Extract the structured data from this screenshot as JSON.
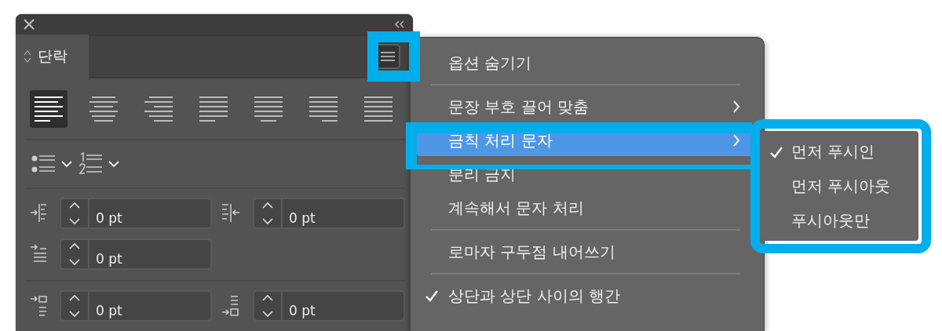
{
  "panel": {
    "tab": {
      "label": "단락",
      "selected": true
    },
    "alignment": [
      {
        "kind": "left",
        "selected": true
      },
      {
        "kind": "center",
        "selected": false
      },
      {
        "kind": "right",
        "selected": false
      },
      {
        "kind": "justify-left",
        "selected": false
      },
      {
        "kind": "justify-center",
        "selected": false
      },
      {
        "kind": "justify-right",
        "selected": false
      },
      {
        "kind": "justify-all",
        "selected": false
      }
    ],
    "field_rows": [
      [
        {
          "kind": "left-indent",
          "value": "0 pt"
        },
        {
          "kind": "right-indent",
          "value": "0 pt"
        }
      ],
      [
        {
          "kind": "first-line-indent",
          "value": "0 pt"
        }
      ],
      [
        {
          "kind": "space-before",
          "value": "0 pt"
        },
        {
          "kind": "space-after",
          "value": "0 pt"
        }
      ]
    ]
  },
  "menu": {
    "items": [
      {
        "kind": "item",
        "label": "옵션 숨기기",
        "submenu": false,
        "checked": false,
        "selected": false
      },
      {
        "kind": "separator"
      },
      {
        "kind": "item",
        "label": "문장 부호 끌어 맞춤",
        "submenu": true,
        "checked": false,
        "selected": false
      },
      {
        "kind": "item",
        "label": "금칙 처리 문자",
        "submenu": true,
        "checked": false,
        "selected": true
      },
      {
        "kind": "item",
        "label": "분리 금지",
        "submenu": false,
        "checked": false,
        "selected": false
      },
      {
        "kind": "item",
        "label": "계속해서 문자 처리",
        "submenu": false,
        "checked": false,
        "selected": false
      },
      {
        "kind": "separator"
      },
      {
        "kind": "item",
        "label": "로마자 구두점 내어쓰기",
        "submenu": false,
        "checked": false,
        "selected": false
      },
      {
        "kind": "separator"
      },
      {
        "kind": "item",
        "label": "상단과 상단 사이의 행간",
        "submenu": false,
        "checked": true,
        "selected": false
      }
    ]
  },
  "submenu": {
    "items": [
      {
        "label": "먼저 푸시인",
        "checked": true
      },
      {
        "label": "먼저 푸시아웃",
        "checked": false
      },
      {
        "label": "푸시아웃만",
        "checked": false
      }
    ]
  }
}
